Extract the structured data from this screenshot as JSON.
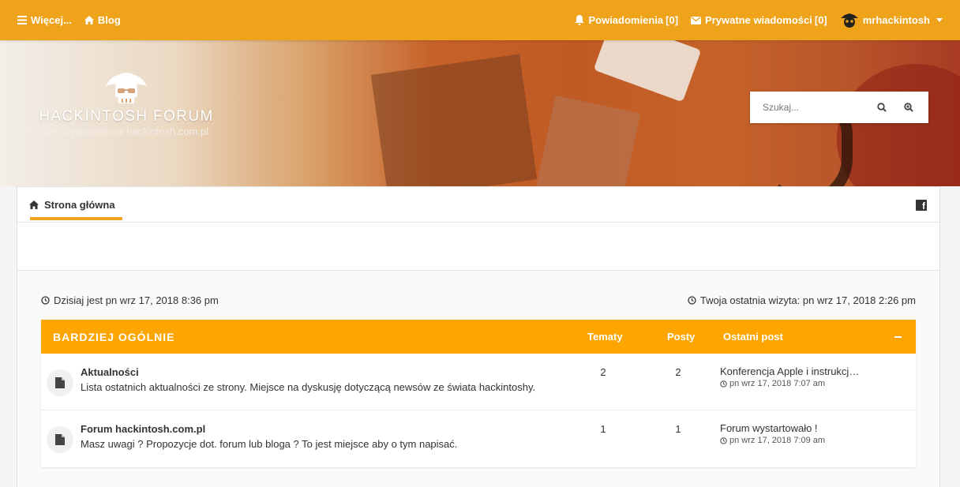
{
  "topbar": {
    "more_label": "Więcej...",
    "blog_label": "Blog",
    "notifications_label": "Powiadomienia",
    "notifications_count": "0",
    "pm_label": "Prywatne wiadomości",
    "pm_count": "[0]",
    "username": "mrhackintosh"
  },
  "header": {
    "site_title": "HACKINTOSH FORUM",
    "site_subtitle": "Forum użytkowników hackintosh.com.pl",
    "search_placeholder": "Szukaj..."
  },
  "nav": {
    "home_label": "Strona główna"
  },
  "info": {
    "today": "Dzisiaj jest pn wrz 17, 2018 8:36 pm",
    "last_visit": "Twoja ostatnia wizyta: pn wrz 17, 2018 2:26 pm"
  },
  "category": {
    "name": "BARDZIEJ OGÓLNIE",
    "col_topics": "Tematy",
    "col_posts": "Posty",
    "col_last": "Ostatni post",
    "forums": [
      {
        "name": "Aktualności",
        "description": "Lista ostatnich aktualności ze strony. Miejsce na dyskusję dotyczącą newsów ze świata hackintoshy.",
        "topics": "2",
        "posts": "2",
        "last_title": "Konferencja Apple i instrukcj…",
        "last_date": "pn wrz 17, 2018 7:07 am"
      },
      {
        "name": "Forum hackintosh.com.pl",
        "description": "Masz uwagi ? Propozycje dot. forum lub bloga ? To jest miejsce aby o tym napisać.",
        "topics": "1",
        "posts": "1",
        "last_title": "Forum wystartowało !",
        "last_date": "pn wrz 17, 2018 7:09 am"
      }
    ]
  },
  "colors": {
    "topbar": "#eea31b",
    "category_header": "#fda601",
    "nav_underline": "#f2a51a"
  },
  "icons": {
    "menu": "bars-icon",
    "blog": "home-icon",
    "notifications": "bell-icon",
    "pm": "envelope-icon",
    "search": "search-icon",
    "advanced_search": "zoom-in-icon",
    "facebook": "facebook-icon",
    "clock": "clock-icon",
    "forum": "file-icon"
  }
}
